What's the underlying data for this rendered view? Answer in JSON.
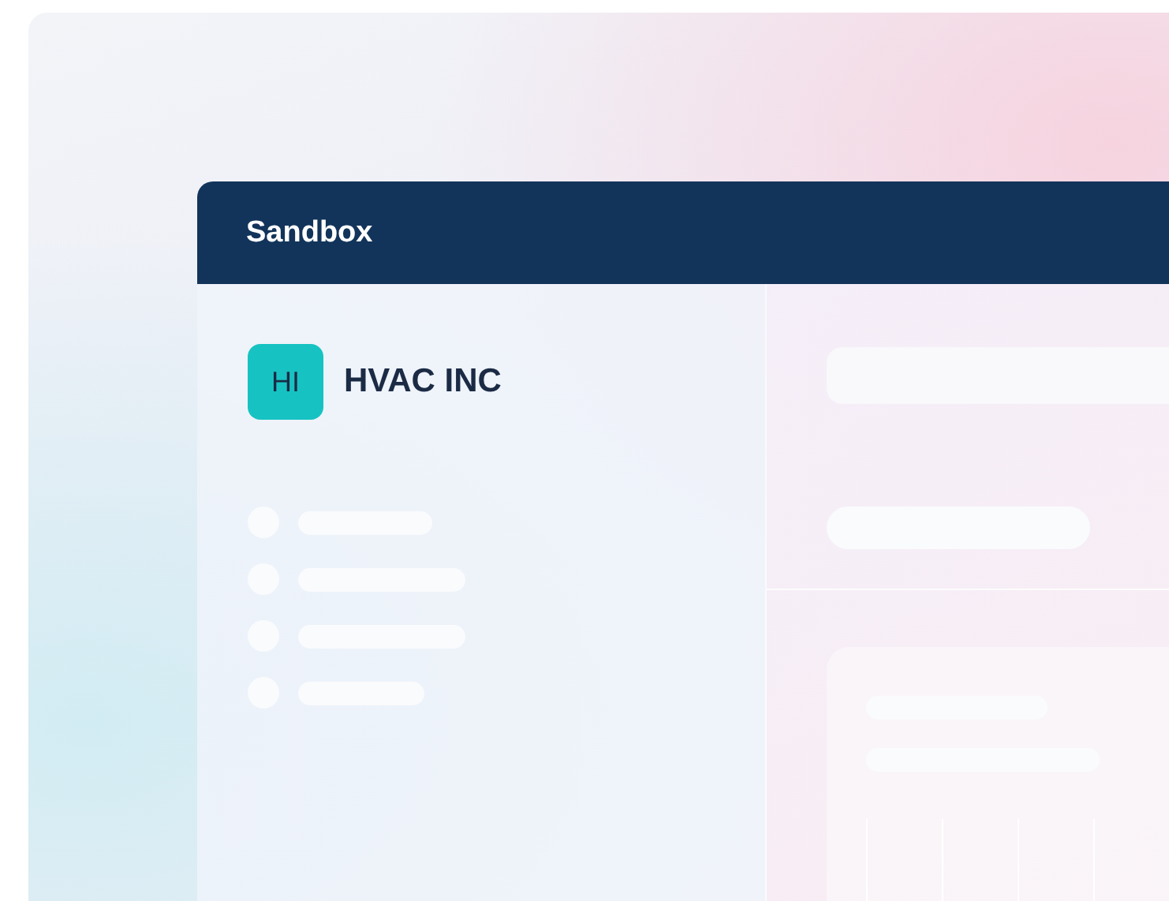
{
  "window": {
    "title": "Sandbox"
  },
  "company": {
    "initials": "HI",
    "name": "HVAC INC"
  }
}
